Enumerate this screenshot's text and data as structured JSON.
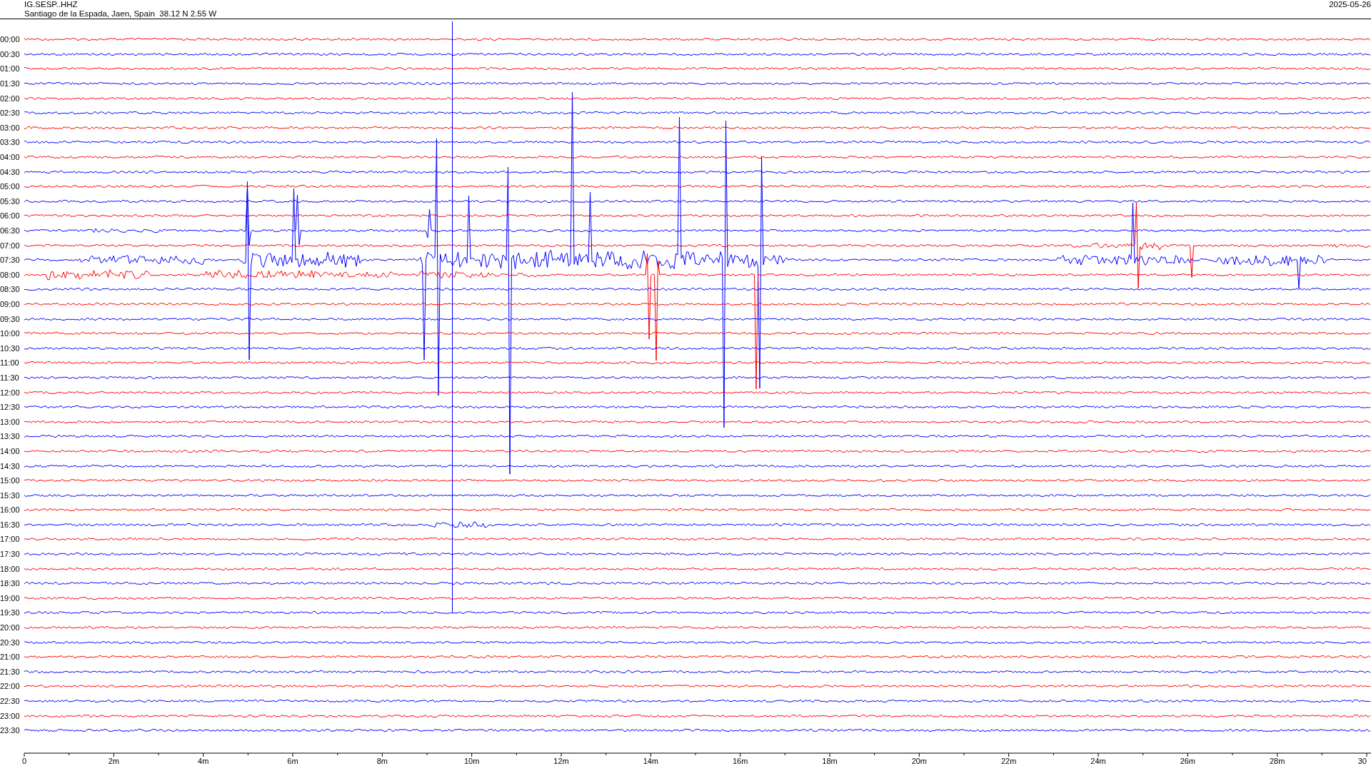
{
  "header": {
    "station": "IG.SESP..HHZ",
    "location": "Santiago de la Espada, Jaen, Spain  38.12 N 2.55 W",
    "date": "2025-05-26"
  },
  "traces": [
    {
      "label": "00:00",
      "color": "#ff0000"
    },
    {
      "label": "00:30",
      "color": "#0000ff"
    },
    {
      "label": "01:00",
      "color": "#ff0000"
    },
    {
      "label": "01:30",
      "color": "#0000ff"
    },
    {
      "label": "02:00",
      "color": "#ff0000"
    },
    {
      "label": "02:30",
      "color": "#0000ff"
    },
    {
      "label": "03:00",
      "color": "#ff0000"
    },
    {
      "label": "03:30",
      "color": "#0000ff"
    },
    {
      "label": "04:00",
      "color": "#ff0000"
    },
    {
      "label": "04:30",
      "color": "#0000ff"
    },
    {
      "label": "05:00",
      "color": "#ff0000"
    },
    {
      "label": "05:30",
      "color": "#0000ff"
    },
    {
      "label": "06:00",
      "color": "#ff0000"
    },
    {
      "label": "06:30",
      "color": "#0000ff"
    },
    {
      "label": "07:00",
      "color": "#ff0000"
    },
    {
      "label": "07:30",
      "color": "#0000ff"
    },
    {
      "label": "08:00",
      "color": "#ff0000"
    },
    {
      "label": "08:30",
      "color": "#0000ff"
    },
    {
      "label": "09:00",
      "color": "#ff0000"
    },
    {
      "label": "09:30",
      "color": "#0000ff"
    },
    {
      "label": "10:00",
      "color": "#ff0000"
    },
    {
      "label": "10:30",
      "color": "#0000ff"
    },
    {
      "label": "11:00",
      "color": "#ff0000"
    },
    {
      "label": "11:30",
      "color": "#0000ff"
    },
    {
      "label": "12:00",
      "color": "#ff0000"
    },
    {
      "label": "12:30",
      "color": "#0000ff"
    },
    {
      "label": "13:00",
      "color": "#ff0000"
    },
    {
      "label": "13:30",
      "color": "#0000ff"
    },
    {
      "label": "14:00",
      "color": "#ff0000"
    },
    {
      "label": "14:30",
      "color": "#0000ff"
    },
    {
      "label": "15:00",
      "color": "#ff0000"
    },
    {
      "label": "15:30",
      "color": "#0000ff"
    },
    {
      "label": "16:00",
      "color": "#ff0000"
    },
    {
      "label": "16:30",
      "color": "#0000ff"
    },
    {
      "label": "17:00",
      "color": "#ff0000"
    },
    {
      "label": "17:30",
      "color": "#0000ff"
    },
    {
      "label": "18:00",
      "color": "#ff0000"
    },
    {
      "label": "18:30",
      "color": "#0000ff"
    },
    {
      "label": "19:00",
      "color": "#ff0000"
    },
    {
      "label": "19:30",
      "color": "#0000ff"
    },
    {
      "label": "20:00",
      "color": "#ff0000"
    },
    {
      "label": "20:30",
      "color": "#0000ff"
    },
    {
      "label": "21:00",
      "color": "#ff0000"
    },
    {
      "label": "21:30",
      "color": "#0000ff"
    },
    {
      "label": "22:00",
      "color": "#ff0000"
    },
    {
      "label": "22:30",
      "color": "#0000ff"
    },
    {
      "label": "23:00",
      "color": "#ff0000"
    },
    {
      "label": "23:30",
      "color": "#0000ff"
    }
  ],
  "time_axis": {
    "tick_labels": [
      "0",
      "2m",
      "4m",
      "6m",
      "8m",
      "10m",
      "12m",
      "14m",
      "16m",
      "18m",
      "20m",
      "22m",
      "24m",
      "26m",
      "28m",
      "30"
    ]
  }
}
